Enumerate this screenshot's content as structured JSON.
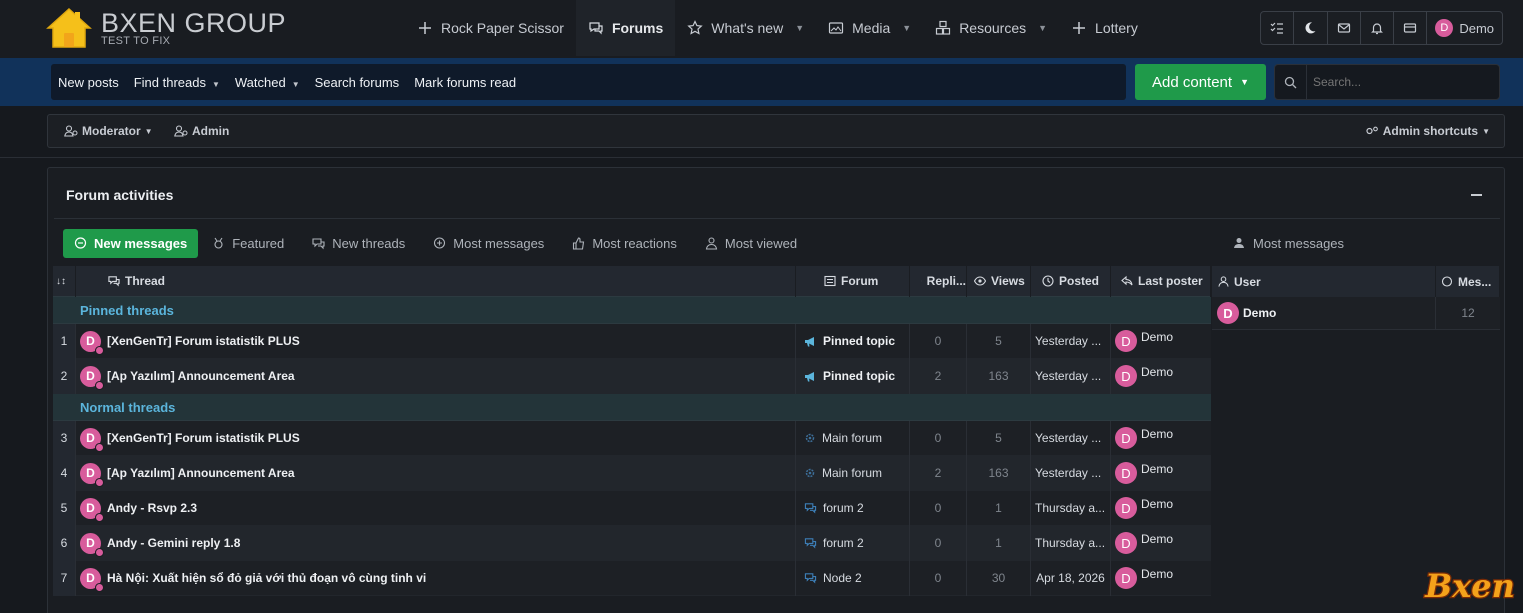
{
  "header": {
    "logo_title": "BXEN GROUP",
    "logo_subtitle": "TEST TO FIX",
    "nav": [
      {
        "label": "Rock Paper Scissor",
        "icon": "plus-icon",
        "caret": false,
        "active": false
      },
      {
        "label": "Forums",
        "icon": "chat-icon",
        "caret": false,
        "active": true
      },
      {
        "label": "What's new",
        "icon": "star-icon",
        "caret": true,
        "active": false
      },
      {
        "label": "Media",
        "icon": "image-icon",
        "caret": true,
        "active": false
      },
      {
        "label": "Resources",
        "icon": "boxes-icon",
        "caret": true,
        "active": false
      },
      {
        "label": "Lottery",
        "icon": "plus-icon",
        "caret": false,
        "active": false
      }
    ],
    "user": {
      "initial": "D",
      "name": "Demo"
    }
  },
  "subnav": {
    "items": [
      {
        "label": "New posts",
        "caret": false
      },
      {
        "label": "Find threads",
        "caret": true
      },
      {
        "label": "Watched",
        "caret": true
      },
      {
        "label": "Search forums",
        "caret": false
      },
      {
        "label": "Mark forums read",
        "caret": false
      }
    ],
    "add_content": "Add content",
    "search_placeholder": "Search..."
  },
  "modbar": {
    "moderator": "Moderator",
    "admin": "Admin",
    "admin_shortcuts": "Admin shortcuts"
  },
  "panel": {
    "title": "Forum activities",
    "tabs": [
      {
        "label": "New messages",
        "active": true
      },
      {
        "label": "Featured",
        "active": false
      },
      {
        "label": "New threads",
        "active": false
      },
      {
        "label": "Most messages",
        "active": false
      },
      {
        "label": "Most reactions",
        "active": false
      },
      {
        "label": "Most viewed",
        "active": false
      }
    ],
    "right_tab": "Most messages"
  },
  "table": {
    "headers": {
      "sort": "↓↕",
      "thread": "Thread",
      "forum": "Forum",
      "replies": "Repli...",
      "views": "Views",
      "posted": "Posted",
      "last_poster": "Last poster"
    },
    "groups": [
      {
        "title": "Pinned threads",
        "rows": [
          {
            "idx": "1",
            "title": "[XenGenTr] Forum istatistik PLUS",
            "forum": "Pinned topic",
            "forum_icon": "megaphone",
            "replies": "0",
            "views": "5",
            "posted": "Yesterday ...",
            "poster": "Demo"
          },
          {
            "idx": "2",
            "title": "[Ap Yazılım] Announcement Area",
            "forum": "Pinned topic",
            "forum_icon": "megaphone",
            "replies": "2",
            "views": "163",
            "posted": "Yesterday ...",
            "poster": "Demo"
          }
        ]
      },
      {
        "title": "Normal threads",
        "rows": [
          {
            "idx": "3",
            "title": "[XenGenTr] Forum istatistik PLUS",
            "forum": "Main forum",
            "forum_icon": "gear",
            "replies": "0",
            "views": "5",
            "posted": "Yesterday ...",
            "poster": "Demo"
          },
          {
            "idx": "4",
            "title": "[Ap Yazılım] Announcement Area",
            "forum": "Main forum",
            "forum_icon": "gear",
            "replies": "2",
            "views": "163",
            "posted": "Yesterday ...",
            "poster": "Demo"
          },
          {
            "idx": "5",
            "title": "Andy - Rsvp 2.3",
            "forum": "forum 2",
            "forum_icon": "chat",
            "replies": "0",
            "views": "1",
            "posted": "Thursday a...",
            "poster": "Demo"
          },
          {
            "idx": "6",
            "title": "Andy - Gemini reply 1.8",
            "forum": "forum 2",
            "forum_icon": "chat",
            "replies": "0",
            "views": "1",
            "posted": "Thursday a...",
            "poster": "Demo"
          },
          {
            "idx": "7",
            "title": "Hà Nội: Xuất hiện sổ đỏ giả với thủ đoạn vô cùng tinh vi",
            "forum": "Node 2",
            "forum_icon": "chat",
            "replies": "0",
            "views": "30",
            "posted": "Apr 18, 2026",
            "poster": "Demo"
          }
        ]
      }
    ],
    "avatar_initial": "D"
  },
  "user_table": {
    "headers": {
      "user": "User",
      "messages": "Mes..."
    },
    "rows": [
      {
        "name": "Demo",
        "count": "12"
      }
    ]
  },
  "brand_watermark": "Bxen",
  "colors": {
    "accent_green": "#1f9a4a",
    "avatar_pink": "#d85c9c",
    "group_title": "#5bb5dc",
    "subnav_band": "#11325a"
  }
}
